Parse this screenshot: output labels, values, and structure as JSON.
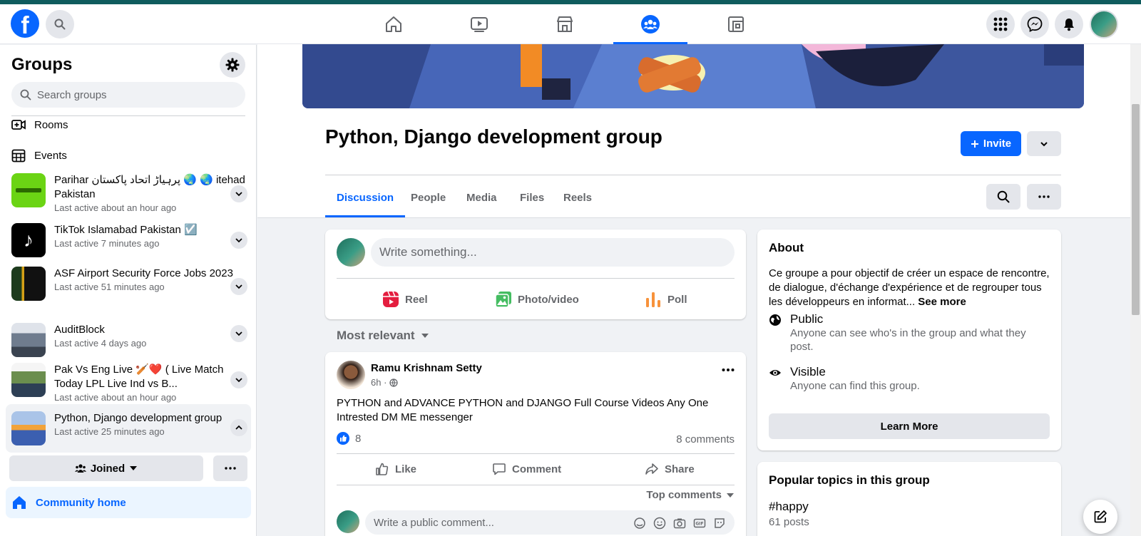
{
  "topnav": {
    "logo": "f",
    "tabs": [
      "home",
      "watch",
      "marketplace",
      "groups",
      "gaming"
    ],
    "active_tab": "groups"
  },
  "sidebar": {
    "title": "Groups",
    "search_placeholder": "Search groups",
    "links": [
      {
        "label": "Rooms",
        "icon": "rooms-icon"
      },
      {
        "label": "Events",
        "icon": "events-icon"
      }
    ],
    "groups": [
      {
        "name": "Parihar پرہیاڑ اتحاد پاکستان 🌏 🌏 itehad Pakistan",
        "meta": "Last active about an hour ago"
      },
      {
        "name": "TikTok Islamabad Pakistan ☑️",
        "meta": "Last active 7 minutes ago"
      },
      {
        "name": "ASF Airport Security Force Jobs 2023",
        "meta": "Last active 51 minutes ago"
      },
      {
        "name": "AuditBlock",
        "meta": "Last active 4 days ago"
      },
      {
        "name": "Pak Vs Eng Live 🏏❤️ ( Live Match Today LPL Live Ind vs B...",
        "meta": "Last active about an hour ago"
      },
      {
        "name": "Python, Django development group",
        "meta": "Last active 25 minutes ago"
      }
    ],
    "joined_label": "Joined",
    "community_home": "Community home"
  },
  "group": {
    "title": "Python, Django development group",
    "invite_label": "Invite",
    "tabs": [
      "Discussion",
      "People",
      "Media",
      "Files",
      "Reels"
    ],
    "active_tab": "Discussion"
  },
  "composer": {
    "placeholder": "Write something...",
    "actions": [
      "Reel",
      "Photo/video",
      "Poll"
    ]
  },
  "feed": {
    "sort_label": "Most relevant"
  },
  "post": {
    "author": "Ramu Krishnam Setty",
    "time": "6h ·",
    "body": "PYTHON and ADVANCE PYTHON and DJANGO Full Course Videos Any One Intrested DM ME messenger",
    "likes": "8",
    "comments": "8 comments",
    "actions": [
      "Like",
      "Comment",
      "Share"
    ],
    "top_comments": "Top comments",
    "comment_placeholder": "Write a public comment..."
  },
  "about": {
    "title": "About",
    "description": "Ce groupe a pour objectif de créer un espace de rencontre, de dialogue, d'échange d'expérience et de regrouper tous les développeurs en informat...",
    "see_more": "See more",
    "public_title": "Public",
    "public_desc": "Anyone can see who's in the group and what they post.",
    "visible_title": "Visible",
    "visible_desc": "Anyone can find this group.",
    "learn_more": "Learn More"
  },
  "topics": {
    "title": "Popular topics in this group",
    "tag": "#happy",
    "count": "61 posts"
  },
  "colors": {
    "brand": "#0866ff",
    "reel": "#e41e3f",
    "photo": "#45bd62",
    "poll": "#f7923b"
  }
}
